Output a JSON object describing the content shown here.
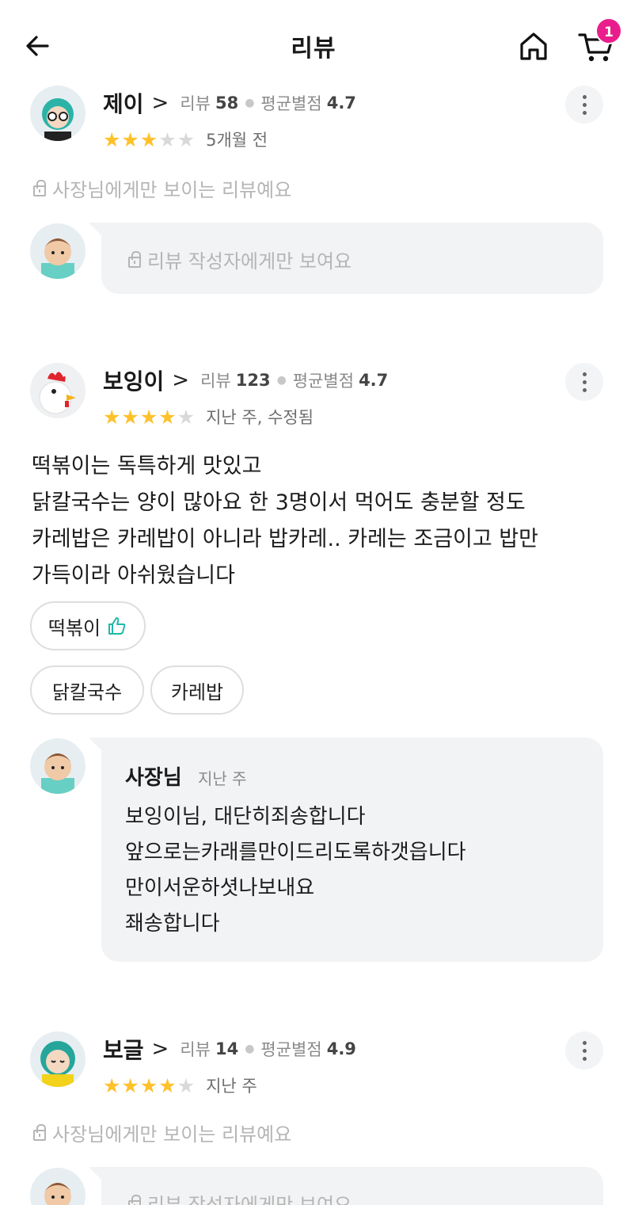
{
  "header": {
    "title": "리뷰",
    "cart_count": "1",
    "icons": {
      "back": "back-arrow-icon",
      "home": "home-icon",
      "cart": "cart-icon"
    }
  },
  "reviews": [
    {
      "name": "제이",
      "review_label": "리뷰",
      "review_count": "58",
      "avg_label": "평균별점",
      "avg_rating": "4.7",
      "rating": 3,
      "date": "5개월 전",
      "private_note": "사장님에게만 보이는 리뷰예요",
      "reply_private": "리뷰 작성자에게만 보여요"
    },
    {
      "name": "보잉이",
      "review_label": "리뷰",
      "review_count": "123",
      "avg_label": "평균별점",
      "avg_rating": "4.7",
      "rating": 4,
      "date": "지난 주, 수정됨",
      "text": "떡볶이는 독특하게 맛있고\n닭칼국수는 양이 많아요 한 3명이서 먹어도 충분할 정도\n카레밥은 카레밥이 아니라 밥카레.. 카레는 조금이고 밥만\n가득이라 아쉬웠습니다",
      "tags": [
        "떡볶이",
        "닭칼국수",
        "카레밥"
      ],
      "owner": {
        "name": "사장님",
        "date": "지난 주",
        "text": "보잉이님, 대단히죄송합니다\n앞으로는카래를만이드리도록하갯읍니다\n만이서운하셧나보내요\n좨송합니다"
      }
    },
    {
      "name": "보글",
      "review_label": "리뷰",
      "review_count": "14",
      "avg_label": "평균별점",
      "avg_rating": "4.9",
      "rating": 4,
      "date": "지난 주",
      "private_note": "사장님에게만 보이는 리뷰예요",
      "reply_private": "리뷰 작성자에게만 보여요"
    }
  ],
  "colors": {
    "star": "#ffc12b",
    "badge": "#e91e8c",
    "reply_bg": "#f2f3f5"
  }
}
